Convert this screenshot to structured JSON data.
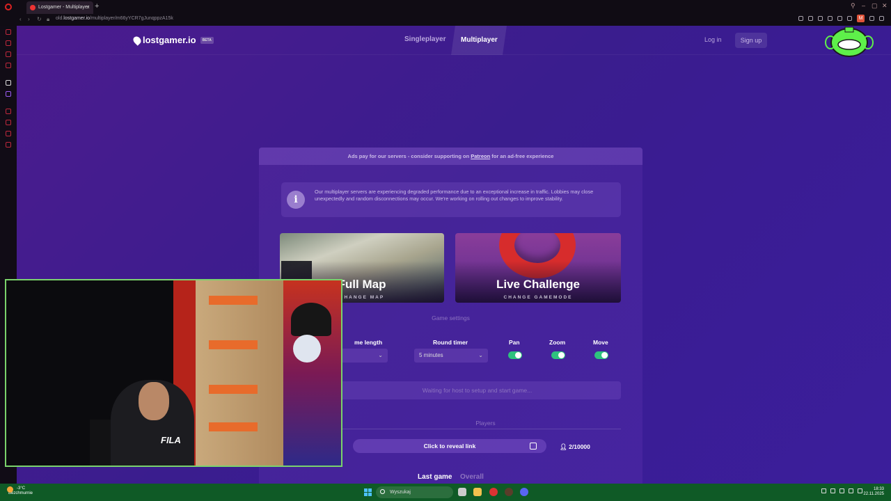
{
  "browser": {
    "tab_title": "Lostgamer - Multiplayer",
    "tab_close": "×",
    "new_tab": "+",
    "url_prefix": "old.",
    "url_domain": "lostgamer.io",
    "url_path": "/multiplayer/m66yYCR7gJunqppzA15k",
    "profile_letter": "M"
  },
  "site": {
    "logo_text": "lostgamer.io",
    "beta_badge": "BETA",
    "nav": {
      "singleplayer": "Singleplayer",
      "multiplayer": "Multiplayer"
    },
    "login": "Log in",
    "signup": "Sign up"
  },
  "ad_bar": {
    "before": "Ads pay for our servers - consider supporting on ",
    "link": "Patreon",
    "after": " for an ad-free experience"
  },
  "notice": {
    "icon": "i",
    "text": "Our multiplayer servers are experiencing degraded performance due to an exceptional increase in traffic. Lobbies may close unexpectedly and random disconnections may occur. We're working on rolling out changes to improve stability."
  },
  "cards": {
    "map": {
      "title": "Full Map",
      "sub": "CHANGE MAP"
    },
    "mode": {
      "title": "Live Challenge",
      "sub": "CHANGE GAMEMODE"
    }
  },
  "settings": {
    "title": "Game settings",
    "game_length_label": "me length",
    "game_length_value": "s",
    "round_timer_label": "Round timer",
    "round_timer_value": "5 minutes",
    "pan": "Pan",
    "zoom": "Zoom",
    "move": "Move"
  },
  "waiting": "Waiting for host to setup and start game...",
  "players": {
    "title": "Players",
    "reveal": "Click to reveal link",
    "count": "2/10000"
  },
  "tabs": {
    "last_game": "Last game",
    "overall": "Overall"
  },
  "taskbar": {
    "temp": "-3°C",
    "weather": "Bezchmurnie",
    "search": "Wyszukaj",
    "time": "18:33",
    "date": "22.11.2025"
  },
  "colors": {
    "accent_green": "#2ec27e",
    "page_purple": "#3b1e9b",
    "taskbar": "#0f5a26"
  }
}
